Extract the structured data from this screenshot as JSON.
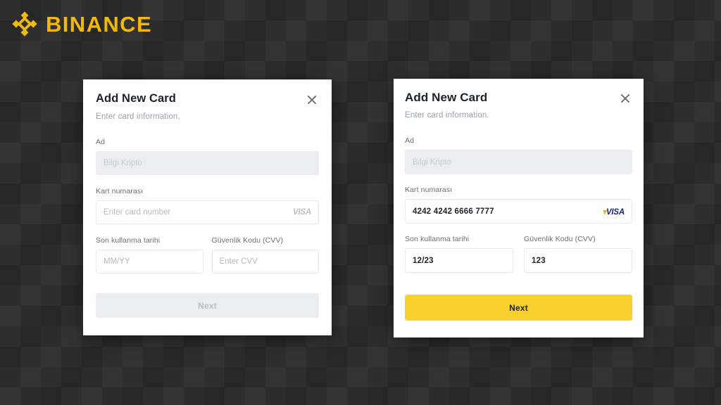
{
  "brand": {
    "name": "BINANCE",
    "logo_color": "#F0B90B",
    "icon": "binance-diamond-logo"
  },
  "background": {
    "base_color": "#2e2e2e",
    "pattern": "diamond-lattice"
  },
  "modals": [
    {
      "state": "empty",
      "title": "Add New Card",
      "subtitle": "Enter card information.",
      "close_icon": "close-icon",
      "fields": {
        "name": {
          "label": "Ad",
          "value": "Bilgi Kripto",
          "placeholder": "Bilgi Kripto",
          "disabled": true
        },
        "card_number": {
          "label": "Kart numarası",
          "value": "",
          "placeholder": "Enter card number",
          "brand_icon": "visa-logo",
          "brand_text": "VISA"
        },
        "expiry": {
          "label": "Son kullanma tarihi",
          "value": "",
          "placeholder": "MM/YY"
        },
        "cvv": {
          "label": "Güvenlik Kodu (CVV)",
          "value": "",
          "placeholder": "Enter CVV"
        }
      },
      "submit": {
        "label": "Next",
        "enabled": false,
        "bg_color": "#ebedf0",
        "text_color": "#b9bdc4"
      }
    },
    {
      "state": "filled",
      "title": "Add New Card",
      "subtitle": "Enter card information.",
      "close_icon": "close-icon",
      "fields": {
        "name": {
          "label": "Ad",
          "value": "Bilgi Kripto",
          "placeholder": "Bilgi Kripto",
          "disabled": true
        },
        "card_number": {
          "label": "Kart numarası",
          "value": "4242 4242 6666 7777",
          "placeholder": "Enter card number",
          "brand_icon": "visa-logo",
          "brand_text": "VISA"
        },
        "expiry": {
          "label": "Son kullanma tarihi",
          "value": "12/23",
          "placeholder": "MM/YY"
        },
        "cvv": {
          "label": "Güvenlik Kodu (CVV)",
          "value": "123",
          "placeholder": "Enter CVV"
        }
      },
      "submit": {
        "label": "Next",
        "enabled": true,
        "bg_color": "#f8d12f",
        "text_color": "#1e2329"
      }
    }
  ]
}
